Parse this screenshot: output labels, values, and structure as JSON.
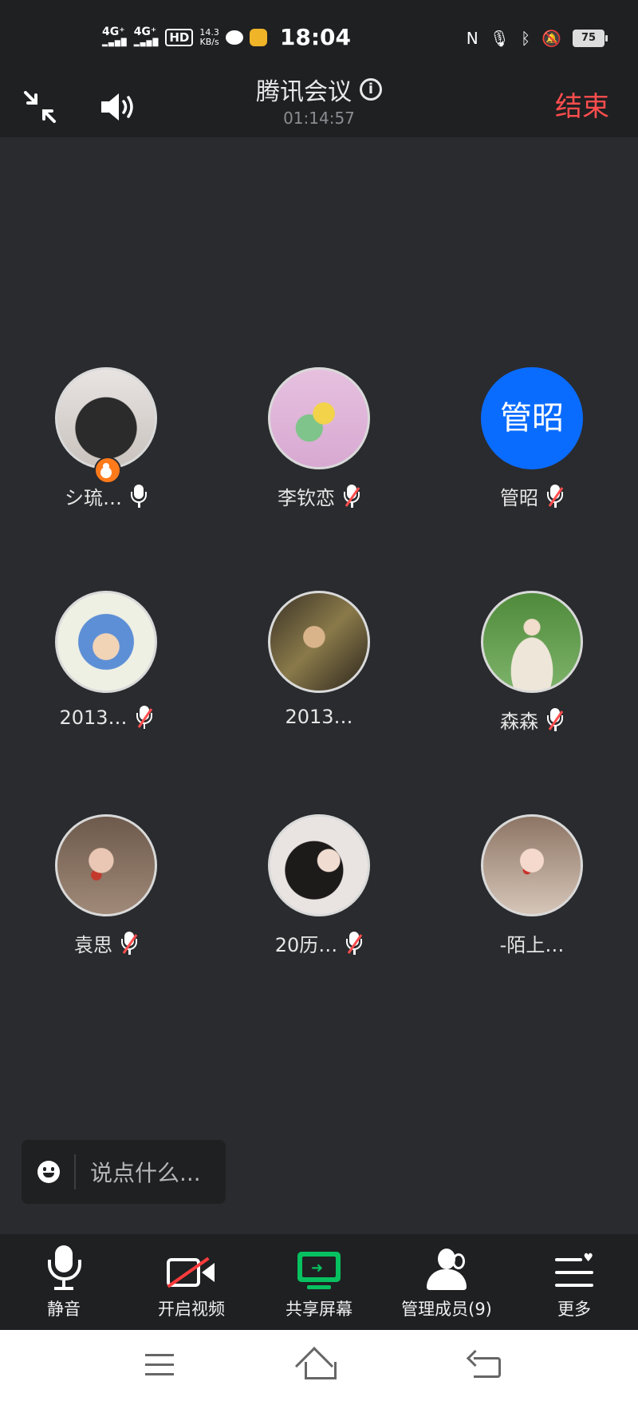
{
  "status_bar": {
    "sig1": "4G⁺",
    "sig2": "4G⁺",
    "hd": "HD",
    "speed": "14.3",
    "speed_unit": "KB/s",
    "time": "18:04",
    "nfc": "N",
    "battery": "75"
  },
  "header": {
    "title": "腾讯会议",
    "duration": "01:14:57",
    "end_label": "结束"
  },
  "participants": [
    {
      "name": "シ琉…",
      "muted": false,
      "host": true,
      "avatar_text": ""
    },
    {
      "name": "李钦恋",
      "muted": true,
      "host": false,
      "avatar_text": ""
    },
    {
      "name": "管昭",
      "muted": true,
      "host": false,
      "avatar_text": "管昭"
    },
    {
      "name": "2013…",
      "muted": true,
      "host": false,
      "avatar_text": ""
    },
    {
      "name": "2013…",
      "muted": null,
      "host": false,
      "avatar_text": ""
    },
    {
      "name": "森森",
      "muted": true,
      "host": false,
      "avatar_text": ""
    },
    {
      "name": "袁思",
      "muted": true,
      "host": false,
      "avatar_text": ""
    },
    {
      "name": "20历…",
      "muted": true,
      "host": false,
      "avatar_text": ""
    },
    {
      "name": "-陌上…",
      "muted": null,
      "host": false,
      "avatar_text": ""
    }
  ],
  "chat": {
    "placeholder": "说点什么..."
  },
  "toolbar": {
    "mute": "静音",
    "video": "开启视频",
    "share": "共享屏幕",
    "members": "管理成员(9)",
    "more": "更多"
  },
  "colors": {
    "background": "#2a2b2e",
    "bar": "#1f2022",
    "end": "#ff4d4d",
    "share": "#07c160",
    "text_avatar": "#0a6cff"
  }
}
